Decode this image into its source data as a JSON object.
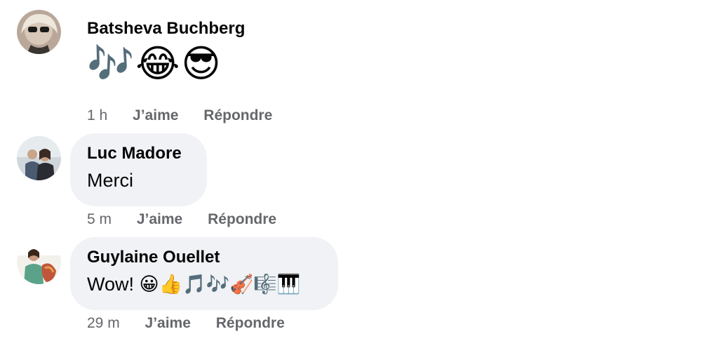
{
  "comments": [
    {
      "author": "Batsheva Buchberg",
      "text": "🎶😂😎",
      "time": "1 h",
      "like_label": "J’aime",
      "reply_label": "Répondre"
    },
    {
      "author": "Luc Madore",
      "text": "Merci",
      "time": "5 m",
      "like_label": "J’aime",
      "reply_label": "Répondre"
    },
    {
      "author": "Guylaine Ouellet",
      "text": "Wow! 😀👍🎵🎶🎻🎼🎹",
      "time": "29 m",
      "like_label": "J’aime",
      "reply_label": "Répondre"
    }
  ]
}
